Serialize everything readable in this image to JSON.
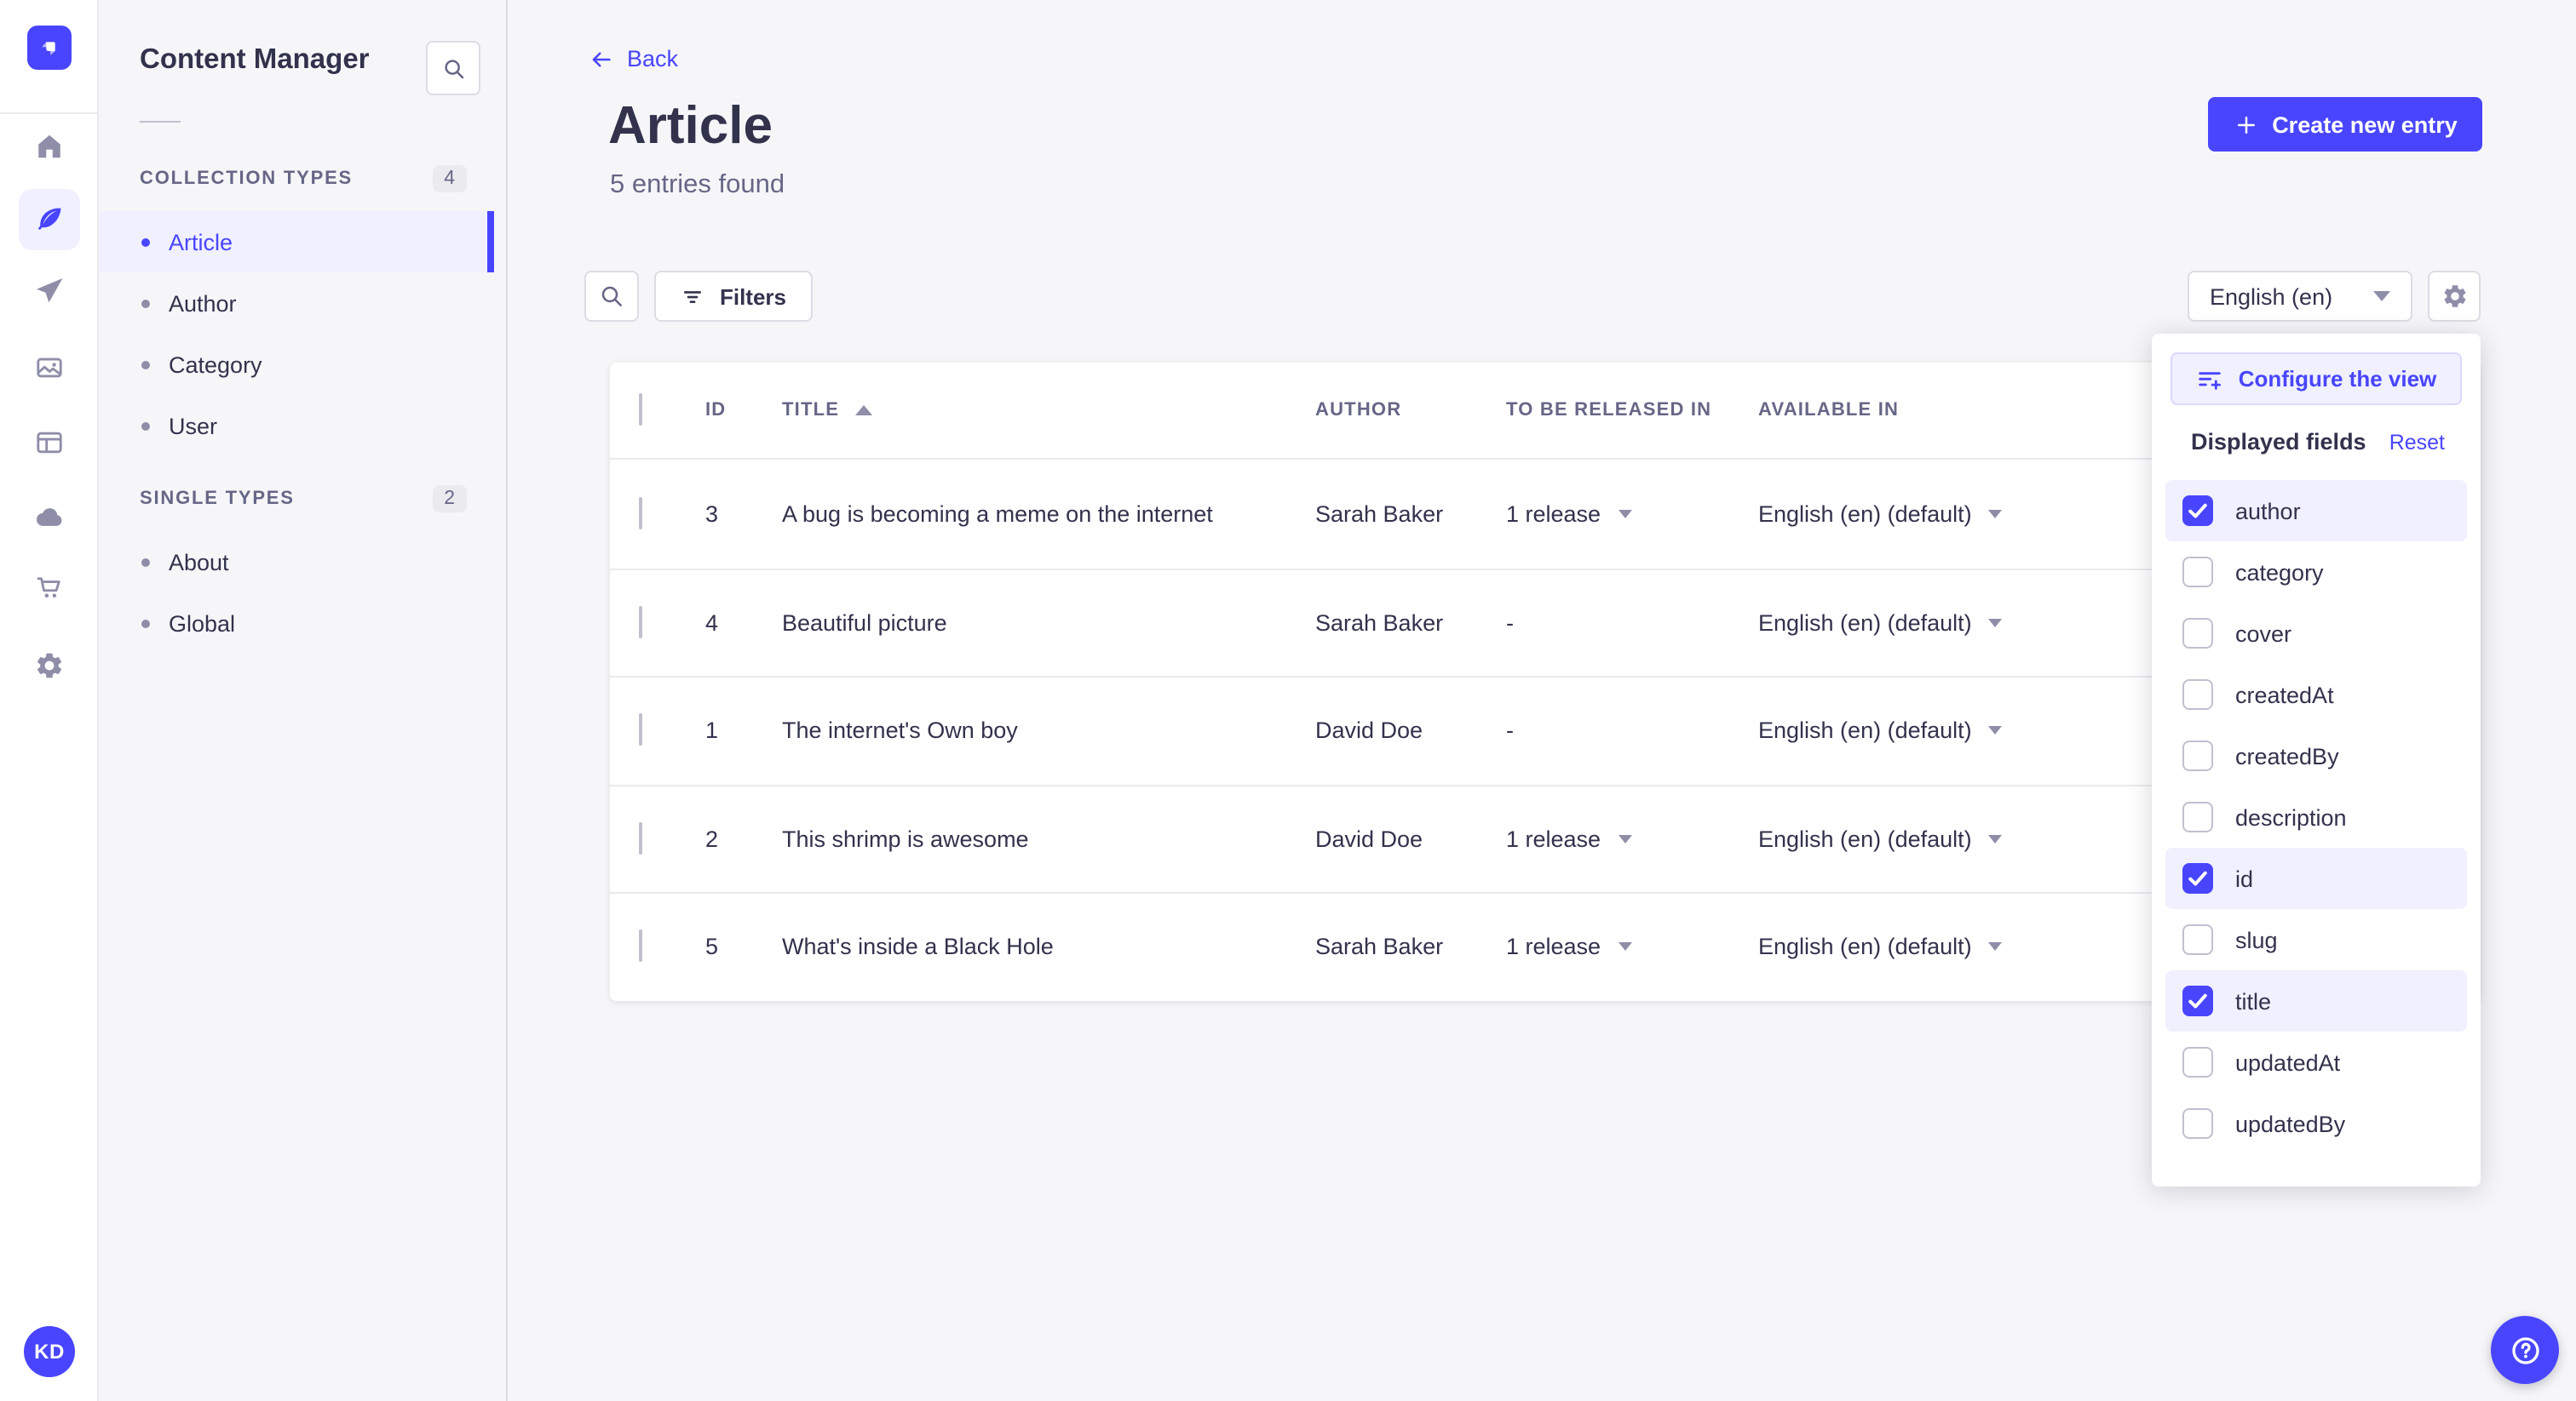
{
  "colors": {
    "primary": "#4945ff",
    "primary_light_bg": "#f0f0ff",
    "primary_border": "#d9d8ff",
    "text_dark": "#32324d",
    "text_secondary": "#666687",
    "icon_muted": "#8e8ea9",
    "border": "#dcdce4",
    "divider": "#eaeaef",
    "surface": "#ffffff",
    "app_bg": "#f6f6f9"
  },
  "rail": {
    "logo_icon": "strapi-logo",
    "items": [
      {
        "icon": "home",
        "active": false
      },
      {
        "icon": "content-manager",
        "active": true
      },
      {
        "icon": "releases",
        "active": false
      },
      {
        "icon": "media-library",
        "active": false
      },
      {
        "icon": "content-type-builder",
        "active": false
      },
      {
        "icon": "deploy",
        "active": false
      },
      {
        "icon": "marketplace",
        "active": false
      },
      {
        "icon": "settings",
        "active": false
      }
    ],
    "avatar_initials": "KD"
  },
  "subnav": {
    "title": "Content Manager",
    "search_icon": "search-icon",
    "sections": [
      {
        "label": "COLLECTION TYPES",
        "count": "4",
        "items": [
          {
            "label": "Article",
            "active": true
          },
          {
            "label": "Author",
            "active": false
          },
          {
            "label": "Category",
            "active": false
          },
          {
            "label": "User",
            "active": false
          }
        ]
      },
      {
        "label": "SINGLE TYPES",
        "count": "2",
        "items": [
          {
            "label": "About",
            "active": false
          },
          {
            "label": "Global",
            "active": false
          }
        ]
      }
    ]
  },
  "header": {
    "back_label": "Back",
    "title": "Article",
    "subtitle": "5 entries found",
    "create_button": "Create new entry"
  },
  "toolbar": {
    "filters_label": "Filters",
    "locale_value": "English (en)"
  },
  "table": {
    "columns": [
      "ID",
      "TITLE",
      "AUTHOR",
      "TO BE RELEASED IN",
      "AVAILABLE IN"
    ],
    "sorted_column": "TITLE",
    "sort_direction": "asc",
    "rows": [
      {
        "id": "3",
        "title": "A bug is becoming a meme on the internet",
        "author": "Sarah Baker",
        "released": "1 release",
        "available": "English (en) (default)"
      },
      {
        "id": "4",
        "title": "Beautiful picture",
        "author": "Sarah Baker",
        "released": "-",
        "available": "English (en) (default)"
      },
      {
        "id": "1",
        "title": "The internet's Own boy",
        "author": "David Doe",
        "released": "-",
        "available": "English (en) (default)"
      },
      {
        "id": "2",
        "title": "This shrimp is awesome",
        "author": "David Doe",
        "released": "1 release",
        "available": "English (en) (default)"
      },
      {
        "id": "5",
        "title": "What's inside a Black Hole",
        "author": "Sarah Baker",
        "released": "1 release",
        "available": "English (en) (default)"
      }
    ]
  },
  "popover": {
    "configure_label": "Configure the view",
    "fields_title": "Displayed fields",
    "reset_label": "Reset",
    "fields": [
      {
        "label": "author",
        "checked": true
      },
      {
        "label": "category",
        "checked": false
      },
      {
        "label": "cover",
        "checked": false
      },
      {
        "label": "createdAt",
        "checked": false
      },
      {
        "label": "createdBy",
        "checked": false
      },
      {
        "label": "description",
        "checked": false
      },
      {
        "label": "id",
        "checked": true
      },
      {
        "label": "slug",
        "checked": false
      },
      {
        "label": "title",
        "checked": true
      },
      {
        "label": "updatedAt",
        "checked": false
      },
      {
        "label": "updatedBy",
        "checked": false
      }
    ]
  },
  "help": {
    "icon": "question-circle"
  }
}
